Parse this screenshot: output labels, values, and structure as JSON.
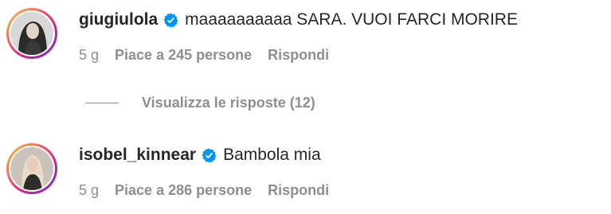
{
  "comments": [
    {
      "username": "giugiulola",
      "text": "maaaaaaaaaa SARA. VUOI FARCI MORIRE",
      "time": "5 g",
      "likes": "Piace a 245 persone",
      "reply": "Rispondi",
      "avatar": "profile-photo"
    },
    {
      "username": "isobel_kinnear",
      "text": "Bambola mia",
      "time": "5 g",
      "likes": "Piace a 286 persone",
      "reply": "Rispondi",
      "avatar": "profile-photo"
    }
  ],
  "replies_toggle": {
    "label": "Visualizza le risposte (12)"
  },
  "colors": {
    "text": "#262626",
    "secondary": "#8e8e8e",
    "verified": "#0095f6",
    "story_ring": [
      "#f9ce34",
      "#ee2a7b",
      "#6228d7"
    ]
  },
  "icons": {
    "verified": "verified-badge-icon"
  }
}
